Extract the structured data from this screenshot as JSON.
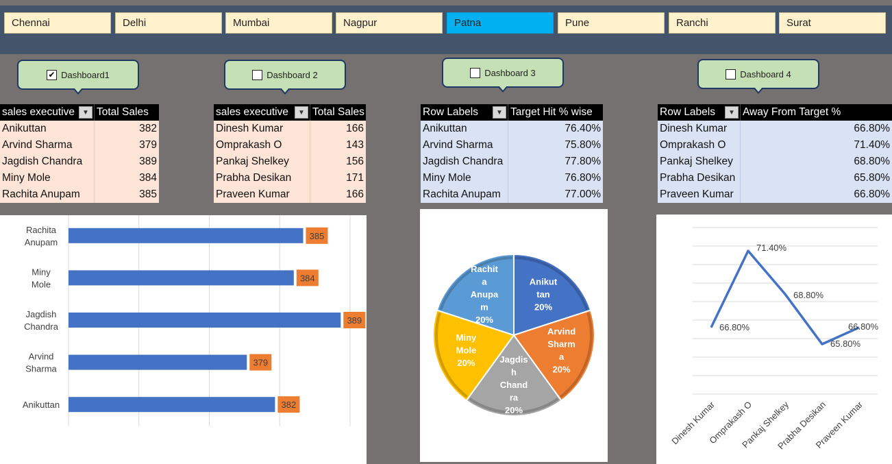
{
  "slicer": {
    "items": [
      {
        "label": "Chennai",
        "selected": false
      },
      {
        "label": "Delhi",
        "selected": false
      },
      {
        "label": "Mumbai",
        "selected": false
      },
      {
        "label": "Nagpur",
        "selected": false
      },
      {
        "label": "Patna",
        "selected": true
      },
      {
        "label": "Pune",
        "selected": false
      },
      {
        "label": "Ranchi",
        "selected": false
      },
      {
        "label": "Surat",
        "selected": false
      }
    ]
  },
  "dashboards": [
    {
      "label": "Dashboard1",
      "checked": true
    },
    {
      "label": "Dashboard 2",
      "checked": false
    },
    {
      "label": "Dashboard 3",
      "checked": false
    },
    {
      "label": "Dashboard 4",
      "checked": false
    }
  ],
  "pivot1": {
    "headers": [
      "sales executive",
      "Total Sales"
    ],
    "rows": [
      [
        "Anikuttan",
        "382"
      ],
      [
        "Arvind Sharma",
        "379"
      ],
      [
        "Jagdish Chandra",
        "389"
      ],
      [
        "Miny Mole",
        "384"
      ],
      [
        "Rachita Anupam",
        "385"
      ]
    ]
  },
  "pivot2": {
    "headers": [
      "sales executive",
      "Total Sales"
    ],
    "rows": [
      [
        "Dinesh Kumar",
        "166"
      ],
      [
        "Omprakash O",
        "143"
      ],
      [
        "Pankaj Shelkey",
        "156"
      ],
      [
        "Prabha Desikan",
        "171"
      ],
      [
        "Praveen Kumar",
        "166"
      ]
    ]
  },
  "pivot3": {
    "headers": [
      "Row Labels",
      "Target Hit % wise"
    ],
    "rows": [
      [
        "Anikuttan",
        "76.40%"
      ],
      [
        "Arvind Sharma",
        "75.80%"
      ],
      [
        "Jagdish Chandra",
        "77.80%"
      ],
      [
        "Miny Mole",
        "76.80%"
      ],
      [
        "Rachita Anupam",
        "77.00%"
      ]
    ]
  },
  "pivot4": {
    "headers": [
      "Row Labels",
      "Away From Target %"
    ],
    "rows": [
      [
        "Dinesh Kumar",
        "66.80%"
      ],
      [
        "Omprakash O",
        "71.40%"
      ],
      [
        "Pankaj Shelkey",
        "68.80%"
      ],
      [
        "Prabha Desikan",
        "65.80%"
      ],
      [
        "Praveen Kumar",
        "66.80%"
      ]
    ]
  },
  "chart_data": [
    {
      "type": "bar",
      "orientation": "horizontal",
      "categories": [
        "Rachita Anupam",
        "Miny Mole",
        "Jagdish Chandra",
        "Arvind Sharma",
        "Anikuttan"
      ],
      "values": [
        385,
        384,
        389,
        379,
        382
      ],
      "data_labels": [
        "385",
        "384",
        "389",
        "379",
        "382"
      ],
      "xlim": [
        360,
        390
      ],
      "grid": true,
      "colors": {
        "bar": "#4472c4",
        "label_bg": "#ed7d31"
      }
    },
    {
      "type": "pie",
      "slices": [
        {
          "name": "Anikuttan",
          "value": 20,
          "label": [
            "Anikut",
            "tan",
            "20%"
          ],
          "color": "#4472c4"
        },
        {
          "name": "Arvind Sharma",
          "value": 20,
          "label": [
            "Arvind",
            "Sharm",
            "a",
            "20%"
          ],
          "color": "#ed7d31"
        },
        {
          "name": "Jagdish Chandra",
          "value": 20,
          "label": [
            "Jagdis",
            "h",
            "Chand",
            "ra",
            "20%"
          ],
          "color": "#a5a5a5"
        },
        {
          "name": "Miny Mole",
          "value": 20,
          "label": [
            "Miny",
            "Mole",
            "20%"
          ],
          "color": "#ffc000"
        },
        {
          "name": "Rachita Anupam",
          "value": 20,
          "label": [
            "Rachit",
            "a",
            "Anupa",
            "m",
            "20%"
          ],
          "color": "#5b9bd5"
        }
      ]
    },
    {
      "type": "line",
      "categories": [
        "Dinesh Kumar",
        "Omprakash O",
        "Pankaj Shelkey",
        "Prabha Desikan",
        "Praveen Kumar"
      ],
      "values": [
        66.8,
        71.4,
        68.8,
        65.8,
        66.8
      ],
      "data_labels": [
        "66.80%",
        "71.40%",
        "68.80%",
        "65.80%",
        "66.80%"
      ],
      "ylim": [
        62.8,
        72.8
      ],
      "grid": true,
      "color": "#4472c4"
    }
  ]
}
